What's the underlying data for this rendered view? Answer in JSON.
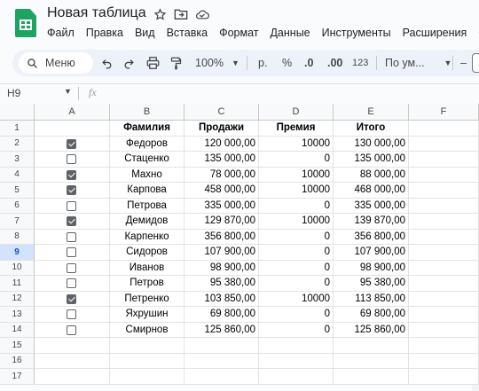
{
  "app": {
    "title": "Новая таблица"
  },
  "menu": [
    "Файл",
    "Правка",
    "Вид",
    "Вставка",
    "Формат",
    "Данные",
    "Инструменты",
    "Расширения",
    "С"
  ],
  "toolbar": {
    "search_label": "Меню",
    "zoom": "100%",
    "currency": "р.",
    "percent": "%",
    "dec_decrease": ".0",
    "dec_increase": ".00",
    "number_format": "123",
    "font_select": "По ум...",
    "dash": "–"
  },
  "formula_bar": {
    "cell_ref": "H9",
    "fx": "fx"
  },
  "columns": [
    "A",
    "B",
    "C",
    "D",
    "E",
    "F"
  ],
  "header_row": {
    "b": "Фамилия",
    "c": "Продажи",
    "d": "Премия",
    "e": "Итого"
  },
  "rows": [
    {
      "checked": true,
      "name": "Федоров",
      "sales": "120 000,00",
      "bonus": "10000",
      "total": "130 000,00"
    },
    {
      "checked": false,
      "name": "Стаценко",
      "sales": "135 000,00",
      "bonus": "0",
      "total": "135 000,00"
    },
    {
      "checked": true,
      "name": "Махно",
      "sales": "78 000,00",
      "bonus": "10000",
      "total": "88 000,00"
    },
    {
      "checked": true,
      "name": "Карпова",
      "sales": "458 000,00",
      "bonus": "10000",
      "total": "468 000,00"
    },
    {
      "checked": false,
      "name": "Петрова",
      "sales": "335 000,00",
      "bonus": "0",
      "total": "335 000,00"
    },
    {
      "checked": true,
      "name": "Демидов",
      "sales": "129 870,00",
      "bonus": "10000",
      "total": "139 870,00"
    },
    {
      "checked": false,
      "name": "Карпенко",
      "sales": "356 800,00",
      "bonus": "0",
      "total": "356 800,00"
    },
    {
      "checked": false,
      "name": "Сидоров",
      "sales": "107 900,00",
      "bonus": "0",
      "total": "107 900,00"
    },
    {
      "checked": false,
      "name": "Иванов",
      "sales": "98 900,00",
      "bonus": "0",
      "total": "98 900,00"
    },
    {
      "checked": false,
      "name": "Петров",
      "sales": "95 380,00",
      "bonus": "0",
      "total": "95 380,00"
    },
    {
      "checked": true,
      "name": "Петренко",
      "sales": "103 850,00",
      "bonus": "10000",
      "total": "113 850,00"
    },
    {
      "checked": false,
      "name": "Яхрушин",
      "sales": "69 800,00",
      "bonus": "0",
      "total": "69 800,00"
    },
    {
      "checked": false,
      "name": "Смирнов",
      "sales": "125 860,00",
      "bonus": "0",
      "total": "125 860,00"
    }
  ],
  "row_numbers": [
    "1",
    "2",
    "3",
    "4",
    "5",
    "6",
    "7",
    "8",
    "9",
    "10",
    "11",
    "12",
    "13",
    "14",
    "15",
    "16",
    "17"
  ],
  "colors": {
    "accent": "#1ea362",
    "selected_row": "#d3e3fd"
  }
}
